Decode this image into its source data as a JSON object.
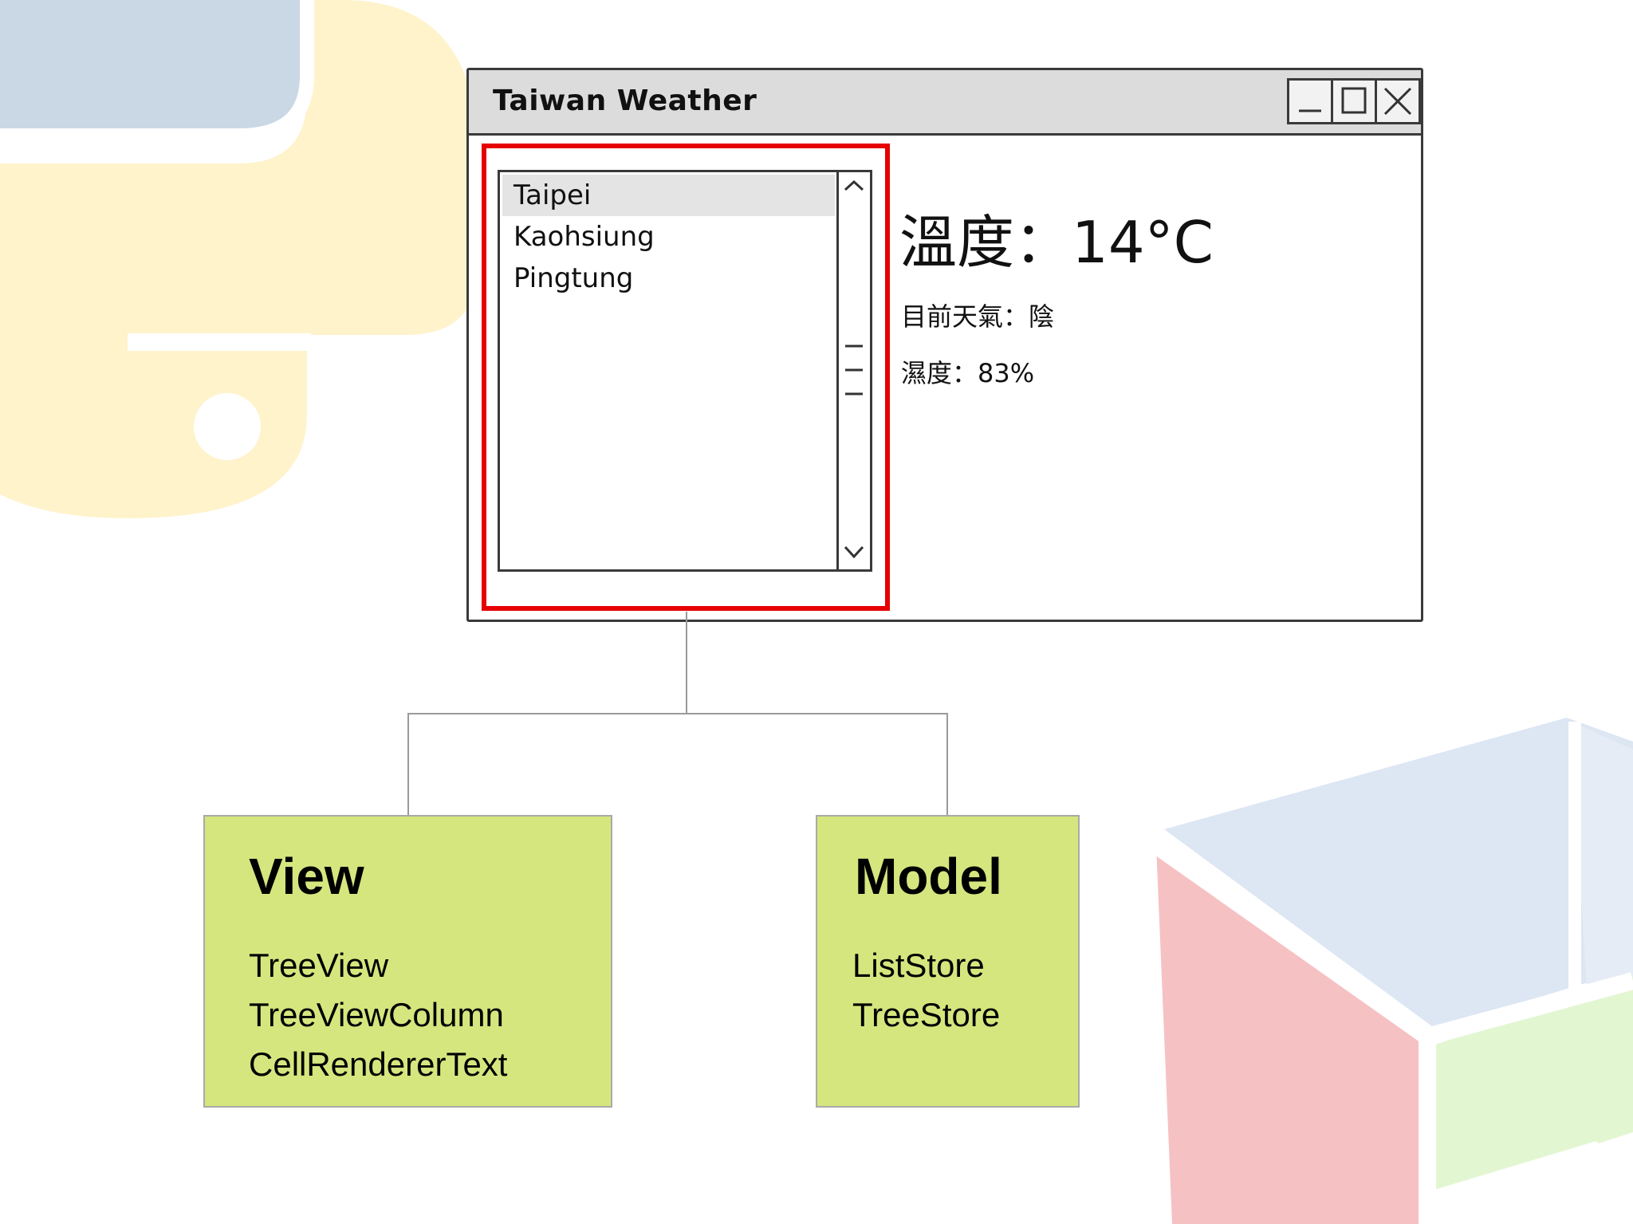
{
  "window": {
    "title": "Taiwan Weather",
    "list_items": [
      "Taipei",
      "Kaohsiung",
      "Pingtung"
    ],
    "temperature_label": "溫度：",
    "temperature_value": "14°C",
    "weather_text": "目前天氣：陰",
    "humidity_text": "濕度：83%"
  },
  "view_box": {
    "title": "View",
    "items": [
      "TreeView",
      "TreeViewColumn",
      "CellRendererText"
    ]
  },
  "model_box": {
    "title": "Model",
    "items": [
      "ListStore",
      "TreeStore"
    ]
  },
  "colors": {
    "highlight": "#e60000",
    "box_fill": "#d6e67e",
    "python_blue": "#c7d6e3",
    "python_yellow": "#fff4c8",
    "cube_red": "#f6c2c4",
    "cube_blue": "#dde7f4",
    "cube_green": "#e2f7cf"
  }
}
